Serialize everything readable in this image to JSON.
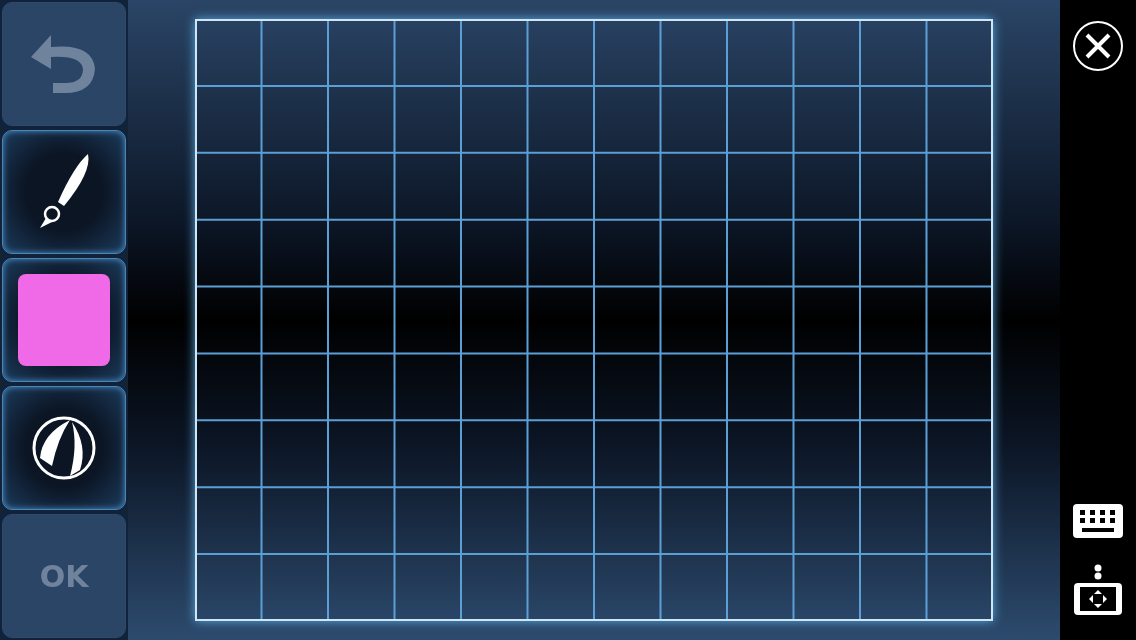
{
  "toolbar": [
    {
      "kind": "undo",
      "disabled": true
    },
    {
      "kind": "brush",
      "disabled": false
    },
    {
      "kind": "color",
      "color": "#f06ae8"
    },
    {
      "kind": "fill",
      "disabled": false
    },
    {
      "kind": "ok",
      "label": "OK",
      "disabled": true
    }
  ]
}
